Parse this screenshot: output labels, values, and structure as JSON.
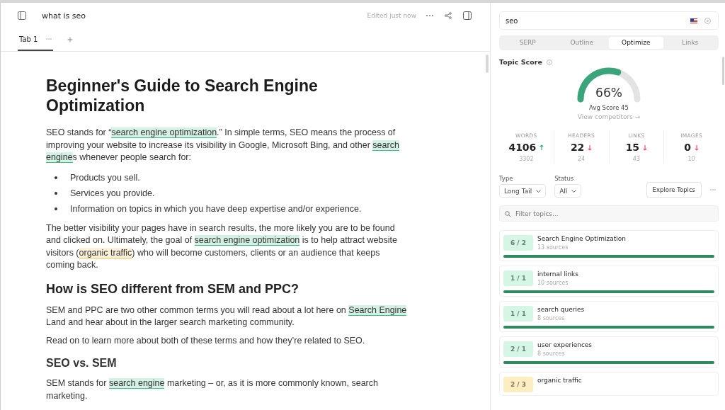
{
  "document": {
    "title": "what is seo",
    "edited": "Edited just now"
  },
  "tabs": [
    {
      "label": "Tab 1",
      "selected": true
    }
  ],
  "content": [
    {
      "kind": "h1",
      "text": "Beginner's Guide to Search Engine Optimization"
    },
    {
      "kind": "p",
      "segments": [
        {
          "text": "SEO stands for “"
        },
        {
          "text": "search engine optimization",
          "color": "#3bbf85"
        },
        {
          "text": ".” In simple terms, SEO means the process of improving your website to increase its visibility in Google, Microsoft Bing, and other "
        },
        {
          "text": "search engine",
          "color": "#3bbf85"
        },
        {
          "text": "s whenever people search for:"
        }
      ]
    },
    {
      "kind": "ul",
      "items": [
        "Products you sell.",
        "Services you provide.",
        "Information on topics in which you have deep expertise and/or experience."
      ]
    },
    {
      "kind": "p",
      "segments": [
        {
          "text": "The better visibility your pages have in search results, the more likely you are to be found and clicked on. Ultimately, the goal of "
        },
        {
          "text": "search engine optimization",
          "color": "#3bbf85"
        },
        {
          "text": " is to help attract website visitors ("
        },
        {
          "text": "organic traffic",
          "color": "#f0c04d"
        },
        {
          "text": ") who will become customers, clients or an audience that keeps coming back."
        }
      ]
    },
    {
      "kind": "h2",
      "text": "How is SEO different from SEM and PPC?"
    },
    {
      "kind": "p",
      "segments": [
        {
          "text": "SEM and PPC are two other common terms you will read about a lot here on "
        },
        {
          "text": "Search Engine",
          "color": "#3bbf85"
        },
        {
          "text": " Land and hear about in the larger search marketing community."
        }
      ]
    },
    {
      "kind": "p",
      "segments": [
        {
          "text": "Read on to learn more about both of these terms and how they’re related to SEO."
        }
      ]
    },
    {
      "kind": "h3",
      "text": "SEO vs. SEM"
    },
    {
      "kind": "p",
      "segments": [
        {
          "text": "SEM stands for "
        },
        {
          "text": "search engine",
          "color": "#3bbf85"
        },
        {
          "text": " marketing – or, as it is more commonly known, search marketing."
        }
      ]
    }
  ],
  "sidebar": {
    "query": "seo",
    "modes": [
      {
        "label": "SERP",
        "selected": false
      },
      {
        "label": "Outline",
        "selected": false
      },
      {
        "label": "Optimize",
        "selected": true
      },
      {
        "label": "Links",
        "selected": false
      }
    ],
    "score_title": "Topic Score",
    "score": {
      "level": 0.66,
      "reading": "66%"
    },
    "avg_score": "Avg Score 45",
    "competitors_link": "View competitors →",
    "stats": [
      {
        "label": "WORDS",
        "value": "4106",
        "up": true,
        "target": "3302"
      },
      {
        "label": "HEADERS",
        "value": "22",
        "up": false,
        "target": "24"
      },
      {
        "label": "LINKS",
        "value": "15",
        "up": false,
        "target": "43"
      },
      {
        "label": "IMAGES",
        "value": "0",
        "up": false,
        "target": "10"
      }
    ],
    "filters": [
      {
        "label": "Type",
        "value": "Long Tail"
      },
      {
        "label": "Status",
        "value": "All"
      }
    ],
    "explore_button": "Explore Topics",
    "filter_placeholder": "Filter topics...",
    "topics": [
      {
        "count": "6 / 2",
        "color": "#d6f6e5",
        "name": "Search Engine Optimization",
        "sources": "13 sources",
        "level": 1
      },
      {
        "count": "1 / 1",
        "color": "#d6f6e5",
        "name": "internal links",
        "sources": "10 sources",
        "level": 1
      },
      {
        "count": "1 / 1",
        "color": "#d6f6e5",
        "name": "search queries",
        "sources": "8 sources",
        "level": 1
      },
      {
        "count": "2 / 1",
        "color": "#d6f6e5",
        "name": "user experiences",
        "sources": "8 sources",
        "level": 1
      },
      {
        "count": "2 / 3",
        "color": "#fdeec2",
        "name": "organic traffic"
      }
    ]
  }
}
